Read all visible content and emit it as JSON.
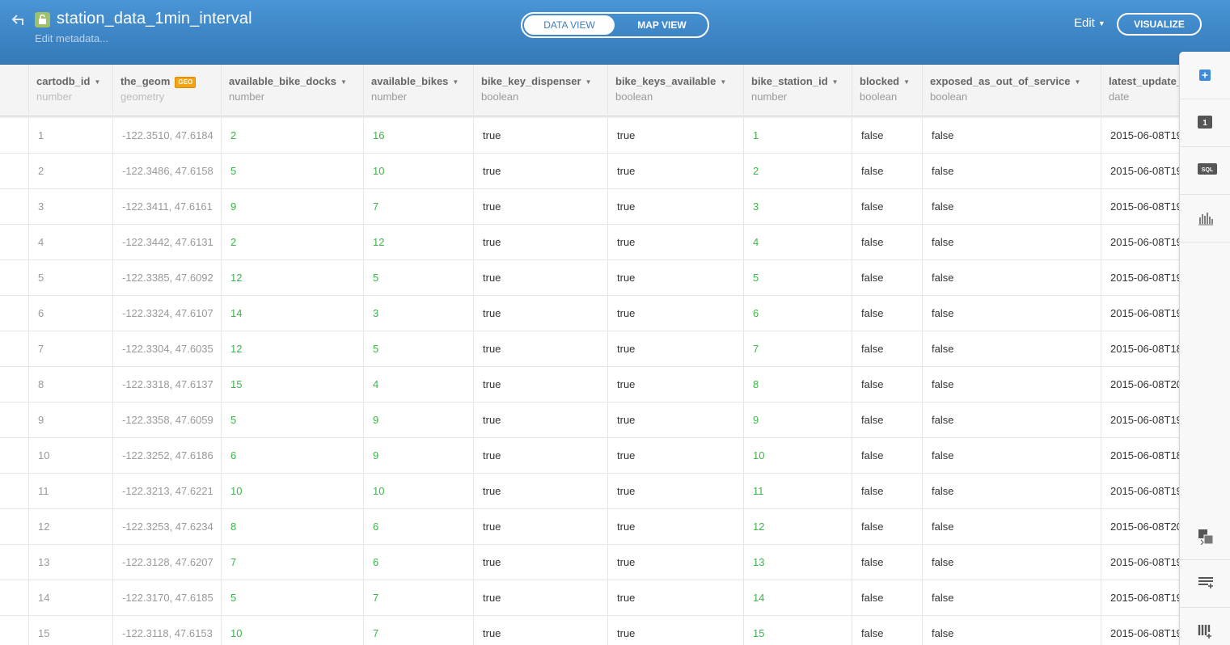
{
  "header": {
    "title": "station_data_1min_interval",
    "edit_metadata": "Edit metadata...",
    "tabs": {
      "data_view": "DATA VIEW",
      "map_view": "MAP VIEW"
    },
    "edit_label": "Edit",
    "visualize_label": "VISUALIZE"
  },
  "columns": [
    {
      "name": "cartodb_id",
      "type": "number"
    },
    {
      "name": "the_geom",
      "type": "geometry",
      "badge": "GEO"
    },
    {
      "name": "available_bike_docks",
      "type": "number"
    },
    {
      "name": "available_bikes",
      "type": "number"
    },
    {
      "name": "bike_key_dispenser",
      "type": "boolean"
    },
    {
      "name": "bike_keys_available",
      "type": "boolean"
    },
    {
      "name": "bike_station_id",
      "type": "number"
    },
    {
      "name": "blocked",
      "type": "boolean"
    },
    {
      "name": "exposed_as_out_of_service",
      "type": "boolean"
    },
    {
      "name": "latest_update_",
      "type": "date"
    }
  ],
  "rows": [
    [
      "1",
      "-122.3510, 47.6184",
      "2",
      "16",
      "true",
      "true",
      "1",
      "false",
      "false",
      "2015-06-08T19"
    ],
    [
      "2",
      "-122.3486, 47.6158",
      "5",
      "10",
      "true",
      "true",
      "2",
      "false",
      "false",
      "2015-06-08T19"
    ],
    [
      "3",
      "-122.3411, 47.6161",
      "9",
      "7",
      "true",
      "true",
      "3",
      "false",
      "false",
      "2015-06-08T19"
    ],
    [
      "4",
      "-122.3442, 47.6131",
      "2",
      "12",
      "true",
      "true",
      "4",
      "false",
      "false",
      "2015-06-08T19"
    ],
    [
      "5",
      "-122.3385, 47.6092",
      "12",
      "5",
      "true",
      "true",
      "5",
      "false",
      "false",
      "2015-06-08T19"
    ],
    [
      "6",
      "-122.3324, 47.6107",
      "14",
      "3",
      "true",
      "true",
      "6",
      "false",
      "false",
      "2015-06-08T19"
    ],
    [
      "7",
      "-122.3304, 47.6035",
      "12",
      "5",
      "true",
      "true",
      "7",
      "false",
      "false",
      "2015-06-08T18"
    ],
    [
      "8",
      "-122.3318, 47.6137",
      "15",
      "4",
      "true",
      "true",
      "8",
      "false",
      "false",
      "2015-06-08T20"
    ],
    [
      "9",
      "-122.3358, 47.6059",
      "5",
      "9",
      "true",
      "true",
      "9",
      "false",
      "false",
      "2015-06-08T19"
    ],
    [
      "10",
      "-122.3252, 47.6186",
      "6",
      "9",
      "true",
      "true",
      "10",
      "false",
      "false",
      "2015-06-08T18"
    ],
    [
      "11",
      "-122.3213, 47.6221",
      "10",
      "10",
      "true",
      "true",
      "11",
      "false",
      "false",
      "2015-06-08T19"
    ],
    [
      "12",
      "-122.3253, 47.6234",
      "8",
      "6",
      "true",
      "true",
      "12",
      "false",
      "false",
      "2015-06-08T20"
    ],
    [
      "13",
      "-122.3128, 47.6207",
      "7",
      "6",
      "true",
      "true",
      "13",
      "false",
      "false",
      "2015-06-08T19"
    ],
    [
      "14",
      "-122.3170, 47.6185",
      "5",
      "7",
      "true",
      "true",
      "14",
      "false",
      "false",
      "2015-06-08T19"
    ],
    [
      "15",
      "-122.3118, 47.6153",
      "10",
      "7",
      "true",
      "true",
      "15",
      "false",
      "false",
      "2015-06-08T19"
    ]
  ],
  "toolbar": {
    "items": [
      {
        "icon": "add-plus-icon"
      },
      {
        "icon": "layer-one-icon",
        "label": "1"
      },
      {
        "icon": "sql-icon",
        "label": "SQL"
      },
      {
        "icon": "histogram-icon"
      },
      {
        "icon": "merge-tables-icon"
      },
      {
        "icon": "add-row-icon"
      },
      {
        "icon": "add-column-icon"
      }
    ]
  },
  "colors": {
    "header_blue": "#3c84c4",
    "number_green": "#3fb44c",
    "geo_badge": "#f4a315",
    "lock_green": "#9ec16a"
  }
}
